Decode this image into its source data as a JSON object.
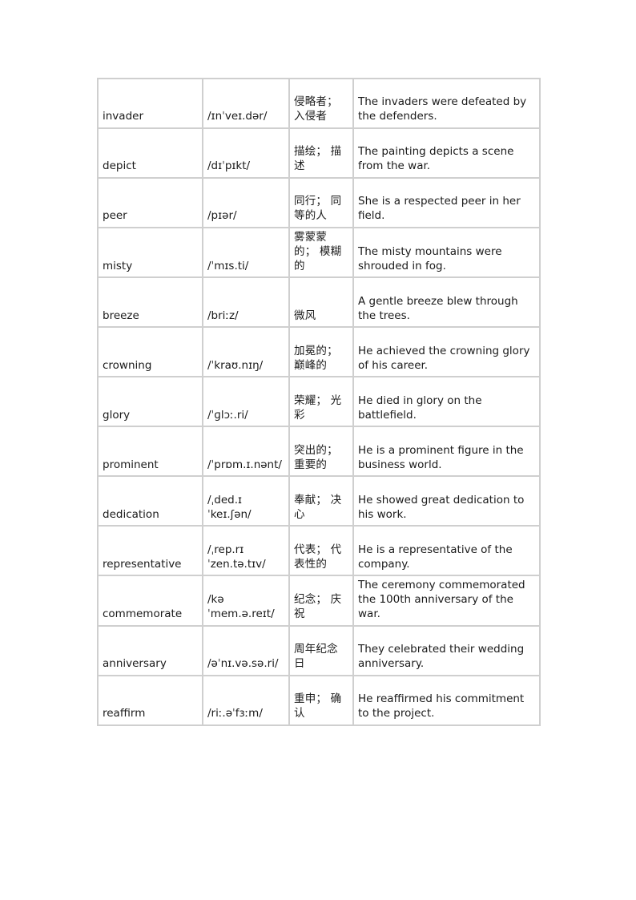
{
  "document": {
    "type": "vocabulary-table",
    "page_background": "#ffffff",
    "text_color": "#1a1a1a",
    "border_color": "#cfcfcf"
  },
  "table": {
    "columns": [
      "word",
      "phonetic",
      "chinese",
      "sentence"
    ],
    "rows": [
      {
        "word": "invader",
        "phonetic": "/ɪnˈveɪ.dər/",
        "chinese": "侵略者；入侵者",
        "sentence": "The invaders were defeated by the defenders."
      },
      {
        "word": "depict",
        "phonetic": "/dɪˈpɪkt/",
        "chinese": "描绘； 描述",
        "sentence": "The painting depicts a scene from the war."
      },
      {
        "word": "peer",
        "phonetic": "/pɪər/",
        "chinese": "同行； 同等的人",
        "sentence": "She is a respected peer in her field."
      },
      {
        "word": "misty",
        "phonetic": "/ˈmɪs.ti/",
        "chinese": "雾蒙蒙的； 模糊的",
        "sentence": "The misty mountains were shrouded in fog."
      },
      {
        "word": "breeze",
        "phonetic": "/briːz/",
        "chinese": "微风",
        "sentence": "A gentle breeze blew through the trees."
      },
      {
        "word": "crowning",
        "phonetic": "/ˈkraʊ.nɪŋ/",
        "chinese": "加冕的；巅峰的",
        "sentence": "He achieved the crowning glory of his career."
      },
      {
        "word": "glory",
        "phonetic": "/ˈɡlɔː.ri/",
        "chinese": "荣耀； 光彩",
        "sentence": "He died in glory on the battlefield."
      },
      {
        "word": "prominent",
        "phonetic": "/ˈprɒm.ɪ.nənt/",
        "chinese": "突出的；重要的",
        "sentence": "He is a prominent figure in the business world."
      },
      {
        "word": "dedication",
        "phonetic": "/ˌded.ɪˈkeɪ.ʃən/",
        "chinese": "奉献； 决心",
        "sentence": "He showed great dedication to his work."
      },
      {
        "word": "representative",
        "phonetic": "/ˌrep.rɪˈzen.tə.tɪv/",
        "chinese": "代表； 代表性的",
        "sentence": "He is a representative of the company."
      },
      {
        "word": "commemorate",
        "phonetic": "/kəˈmem.ə.reɪt/",
        "chinese": "纪念； 庆祝",
        "sentence": "The ceremony commemorated the 100th anniversary of the war."
      },
      {
        "word": "anniversary",
        "phonetic": "/əˈnɪ.və.sə.ri/",
        "chinese": "周年纪念日",
        "sentence": "They celebrated their wedding anniversary."
      },
      {
        "word": "reaffirm",
        "phonetic": "/riː.əˈfɜːm/",
        "chinese": "重申； 确认",
        "sentence": "He reaffirmed his commitment to the project."
      }
    ]
  }
}
